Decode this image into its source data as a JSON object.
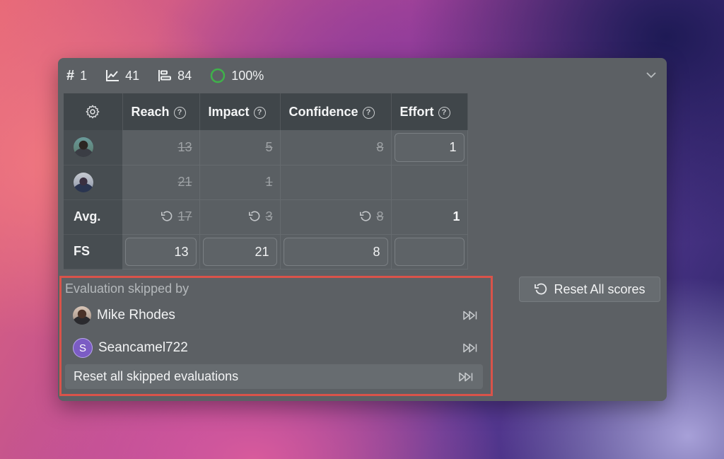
{
  "stats": {
    "rank_symbol": "#",
    "rank": "1",
    "trend": "41",
    "bars": "84",
    "progress": "100%",
    "progress_fraction": 1.0
  },
  "table": {
    "columns": [
      {
        "label": "Reach"
      },
      {
        "label": "Impact"
      },
      {
        "label": "Confidence"
      },
      {
        "label": "Effort"
      }
    ],
    "help_glyph": "?",
    "rows": {
      "user1": {
        "reach": "13",
        "impact": "5",
        "confidence": "8",
        "effort": "1"
      },
      "user2": {
        "reach": "21",
        "impact": "1",
        "confidence": "",
        "effort": ""
      },
      "avg": {
        "label": "Avg.",
        "reach": "17",
        "impact": "3",
        "confidence": "8",
        "effort": "1"
      },
      "fs": {
        "label": "FS",
        "reach": "13",
        "impact": "21",
        "confidence": "8",
        "effort": ""
      }
    }
  },
  "skipped": {
    "title": "Evaluation skipped by",
    "users": [
      {
        "name": "Mike Rhodes"
      },
      {
        "name": "Seancamel722",
        "initial": "S"
      }
    ],
    "reset_label": "Reset all skipped evaluations"
  },
  "reset_all_label": "Reset All scores",
  "colors": {
    "panel": "#5c6064",
    "header": "#40464a",
    "highlight_border": "#d9534a",
    "progress_ring": "#3fb24a",
    "avatar_s": "#7b5cc4"
  }
}
